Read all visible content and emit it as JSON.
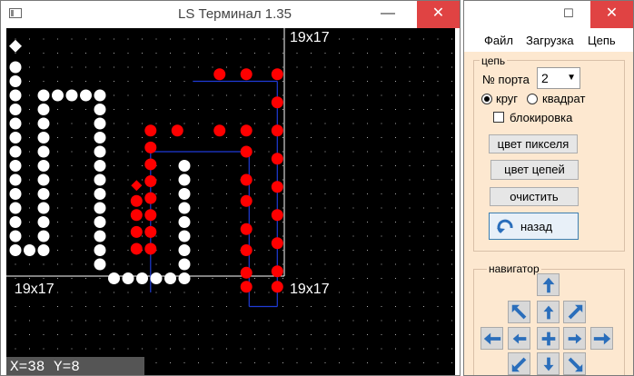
{
  "main_window": {
    "title": "LS Терминал 1.35",
    "controls": {
      "minimize": "—",
      "maximize": "☐",
      "close": "✕"
    },
    "canvas": {
      "label_top_right": "19x17",
      "label_bottom_left": "19x17",
      "label_bottom_right": "19x17",
      "status": "X=38  Y=8",
      "colors": {
        "background": "#000000",
        "white_pixel": "#ffffff",
        "red_pixel": "#ff0000",
        "chain_line": "#1f3bd6",
        "frame": "#ffffff"
      }
    }
  },
  "side_window": {
    "controls": {
      "maximize": "☐",
      "close": "✕"
    },
    "menu": [
      "Файл",
      "Загрузка",
      "Цепь"
    ],
    "chain_group": {
      "legend": "цепь",
      "port_label": "№ порта",
      "port_value": "2",
      "radio_circle": "круг",
      "radio_square": "квадрат",
      "selected_shape": "круг",
      "lock_label": "блокировка",
      "lock_checked": false,
      "btn_pixel_color": "цвет пикселя",
      "btn_chain_color": "цвет цепей",
      "btn_clear": "очистить",
      "btn_back": "назад"
    },
    "navigator": {
      "legend": "навигатор",
      "buttons": [
        "up",
        "up-left-corner",
        "up-small",
        "up-right-corner",
        "left",
        "left-small",
        "center",
        "right-small",
        "right",
        "down-left-corner",
        "down-small",
        "down-right-corner"
      ]
    },
    "colors": {
      "panel_bg": "#fde8d0",
      "icon_blue": "#2a6ebb"
    }
  }
}
